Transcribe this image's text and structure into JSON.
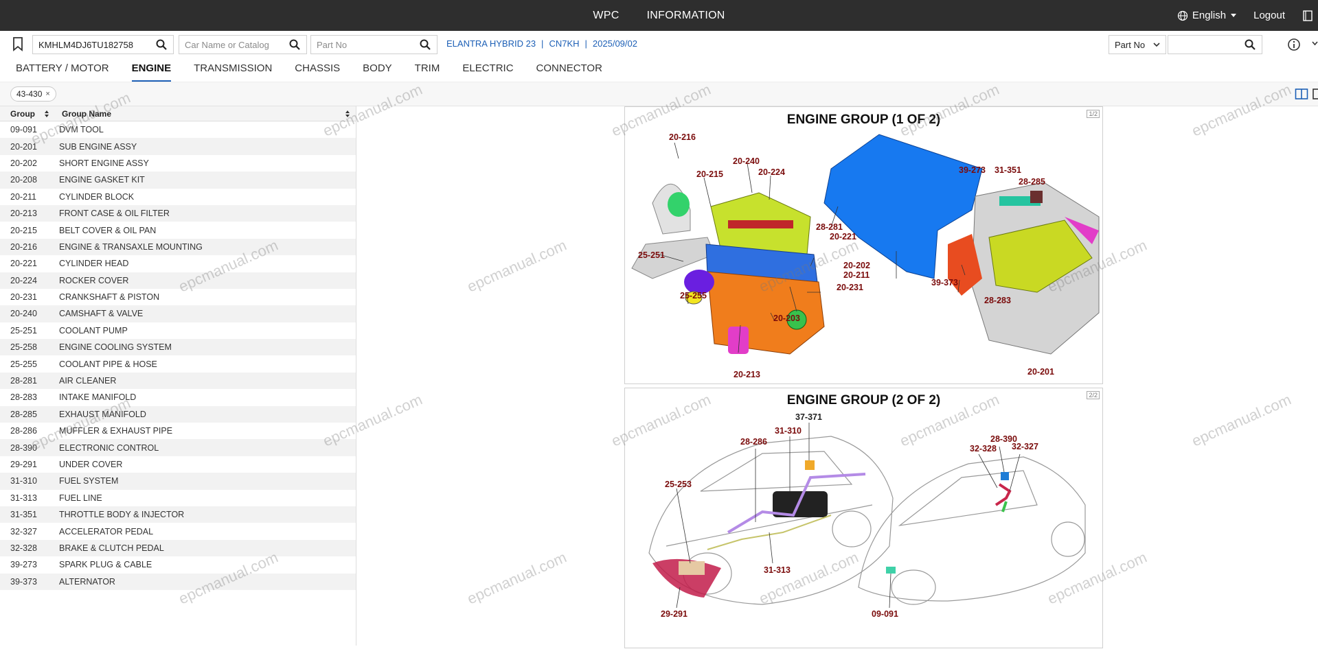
{
  "topbar": {
    "nav": [
      "WPC",
      "INFORMATION"
    ],
    "language": "English",
    "logout": "Logout"
  },
  "search": {
    "vin_value": "KMHLM4DJ6TU182758",
    "car_placeholder": "Car Name or Catalog",
    "partno_placeholder": "Part No",
    "vehicle_model": "ELANTRA HYBRID 23",
    "vehicle_code": "CN7KH",
    "vehicle_date": "2025/09/02",
    "right_select": "Part No",
    "right_value": ""
  },
  "tabs": [
    {
      "label": "BATTERY / MOTOR",
      "active": false
    },
    {
      "label": "ENGINE",
      "active": true
    },
    {
      "label": "TRANSMISSION",
      "active": false
    },
    {
      "label": "CHASSIS",
      "active": false
    },
    {
      "label": "BODY",
      "active": false
    },
    {
      "label": "TRIM",
      "active": false
    },
    {
      "label": "ELECTRIC",
      "active": false
    },
    {
      "label": "CONNECTOR",
      "active": false
    }
  ],
  "filter": {
    "chip": "43-430",
    "chip_close": "×"
  },
  "table": {
    "col_group": "Group",
    "col_name": "Group Name",
    "rows": [
      {
        "code": "09-091",
        "name": "DVM TOOL"
      },
      {
        "code": "20-201",
        "name": "SUB ENGINE ASSY"
      },
      {
        "code": "20-202",
        "name": "SHORT ENGINE ASSY"
      },
      {
        "code": "20-208",
        "name": "ENGINE GASKET KIT"
      },
      {
        "code": "20-211",
        "name": "CYLINDER BLOCK"
      },
      {
        "code": "20-213",
        "name": "FRONT CASE & OIL FILTER"
      },
      {
        "code": "20-215",
        "name": "BELT COVER & OIL PAN"
      },
      {
        "code": "20-216",
        "name": "ENGINE & TRANSAXLE MOUNTING"
      },
      {
        "code": "20-221",
        "name": "CYLINDER HEAD"
      },
      {
        "code": "20-224",
        "name": "ROCKER COVER"
      },
      {
        "code": "20-231",
        "name": "CRANKSHAFT & PISTON"
      },
      {
        "code": "20-240",
        "name": "CAMSHAFT & VALVE"
      },
      {
        "code": "25-251",
        "name": "COOLANT PUMP"
      },
      {
        "code": "25-258",
        "name": "ENGINE COOLING SYSTEM"
      },
      {
        "code": "25-255",
        "name": "COOLANT PIPE & HOSE"
      },
      {
        "code": "28-281",
        "name": "AIR CLEANER"
      },
      {
        "code": "28-283",
        "name": "INTAKE MANIFOLD"
      },
      {
        "code": "28-285",
        "name": "EXHAUST MANIFOLD"
      },
      {
        "code": "28-286",
        "name": "MUFFLER & EXHAUST PIPE"
      },
      {
        "code": "28-390",
        "name": "ELECTRONIC CONTROL"
      },
      {
        "code": "29-291",
        "name": "UNDER COVER"
      },
      {
        "code": "31-310",
        "name": "FUEL SYSTEM"
      },
      {
        "code": "31-313",
        "name": "FUEL LINE"
      },
      {
        "code": "31-351",
        "name": "THROTTLE BODY & INJECTOR"
      },
      {
        "code": "32-327",
        "name": "ACCELERATOR PEDAL"
      },
      {
        "code": "32-328",
        "name": "BRAKE & CLUTCH PEDAL"
      },
      {
        "code": "39-273",
        "name": "SPARK PLUG & CABLE"
      },
      {
        "code": "39-373",
        "name": "ALTERNATOR"
      }
    ]
  },
  "figures": {
    "fig1": {
      "title": "ENGINE GROUP (1 OF 2)",
      "page": "1/2",
      "callouts": [
        "20-216",
        "20-240",
        "20-224",
        "20-215",
        "39-273",
        "31-351",
        "28-285",
        "28-281",
        "20-221",
        "25-251",
        "20-202",
        "20-211",
        "20-231",
        "39-373",
        "25-255",
        "20-203",
        "28-283",
        "20-213",
        "20-201"
      ]
    },
    "fig2": {
      "title": "ENGINE GROUP (2 OF 2)",
      "page": "2/2",
      "callouts": [
        "37-371",
        "31-310",
        "28-286",
        "28-390",
        "32-328",
        "32-327",
        "25-253",
        "31-313",
        "29-291",
        "09-091"
      ]
    }
  },
  "watermark": "epcmanual.com",
  "colors": {
    "topbar": "#2e2e2e",
    "link": "#1c5fb6",
    "callout": "#7a0b0b"
  }
}
